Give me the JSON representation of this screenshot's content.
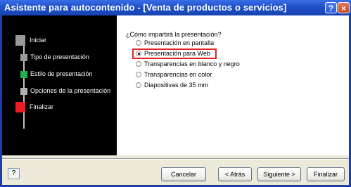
{
  "window": {
    "title": "Asistente para autocontenido - [Venta de productos o servicios]",
    "help_label": "?",
    "close_label": "×"
  },
  "steps": [
    {
      "label": "Iniciar",
      "color": "#9a9a9a"
    },
    {
      "label": "Tipo de presentación",
      "color": "#9a9a9a"
    },
    {
      "label": "Estilo de presentación",
      "color": "#22b14c"
    },
    {
      "label": "Opciones de la presentación",
      "color": "#b0b0b0"
    },
    {
      "label": "Finalizar",
      "color": "#ed1c24"
    }
  ],
  "content": {
    "question": "¿Cómo impartirá la presentación?",
    "options": [
      {
        "label": "Presentación en pantalla",
        "selected": false
      },
      {
        "label": "Presentación para Web",
        "selected": true
      },
      {
        "label": "Transparencias en blanco y negro",
        "selected": false
      },
      {
        "label": "Transparencias en color",
        "selected": false
      },
      {
        "label": "Diapositivas de 35 mm",
        "selected": false
      }
    ]
  },
  "footer": {
    "help_icon": "help-icon",
    "cancel": "Cancelar",
    "back": "< Atrás",
    "next": "Siguiente >",
    "finish": "Finalizar"
  }
}
